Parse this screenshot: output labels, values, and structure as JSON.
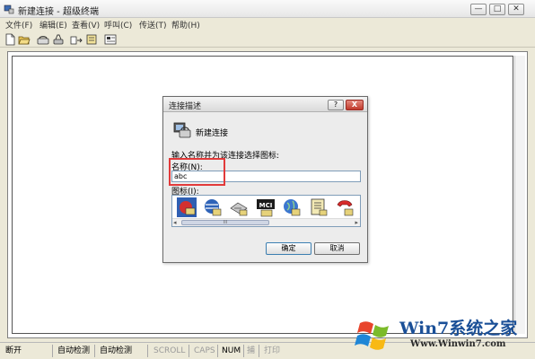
{
  "window": {
    "title": "新建连接 - 超级终端",
    "min_glyph": "—",
    "max_glyph": "□",
    "close_glyph": "✕"
  },
  "menu": [
    {
      "label": "文件(F)"
    },
    {
      "label": "编辑(E)"
    },
    {
      "label": "查看(V)"
    },
    {
      "label": "呼叫(C)"
    },
    {
      "label": "传送(T)"
    },
    {
      "label": "帮助(H)"
    }
  ],
  "toolbar": {
    "icons": [
      "new-document-icon",
      "open-folder-icon",
      "call-icon",
      "disconnect-icon",
      "send-icon",
      "receive-icon",
      "properties-icon"
    ]
  },
  "dialog": {
    "title": "连接描述",
    "help_glyph": "?",
    "close_glyph": "X",
    "connection_label": "新建连接",
    "prompt": "输入名称并为该连接选择图标:",
    "name_label": "名称(N):",
    "name_value": "abc",
    "icon_label": "图标(I):",
    "icons": [
      "phone-red-icon",
      "globe-icon",
      "modem-icon",
      "mci-icon",
      "globe-blue-icon",
      "document-icon",
      "red-phone-icon"
    ],
    "mci_text": "MCI",
    "scroll_left_glyph": "◂",
    "scroll_right_glyph": "▸",
    "scroll_thumb_glyph": "III",
    "ok_label": "确定",
    "cancel_label": "取消"
  },
  "statusbar": {
    "items": [
      {
        "label": "断开",
        "enabled": true
      },
      {
        "label": "自动检测",
        "enabled": true
      },
      {
        "label": "自动检测",
        "enabled": true
      },
      {
        "label": "SCROLL",
        "enabled": false
      },
      {
        "label": "CAPS",
        "enabled": false
      },
      {
        "label": "NUM",
        "enabled": true
      },
      {
        "label": "捕",
        "enabled": false
      },
      {
        "label": "打印",
        "enabled": false
      }
    ]
  },
  "watermark": {
    "brand": "Win7系统之家",
    "url": "Www.Winwin7.com"
  },
  "colors": {
    "highlight": "#e23a3a",
    "brand_blue": "#1a4f97"
  }
}
